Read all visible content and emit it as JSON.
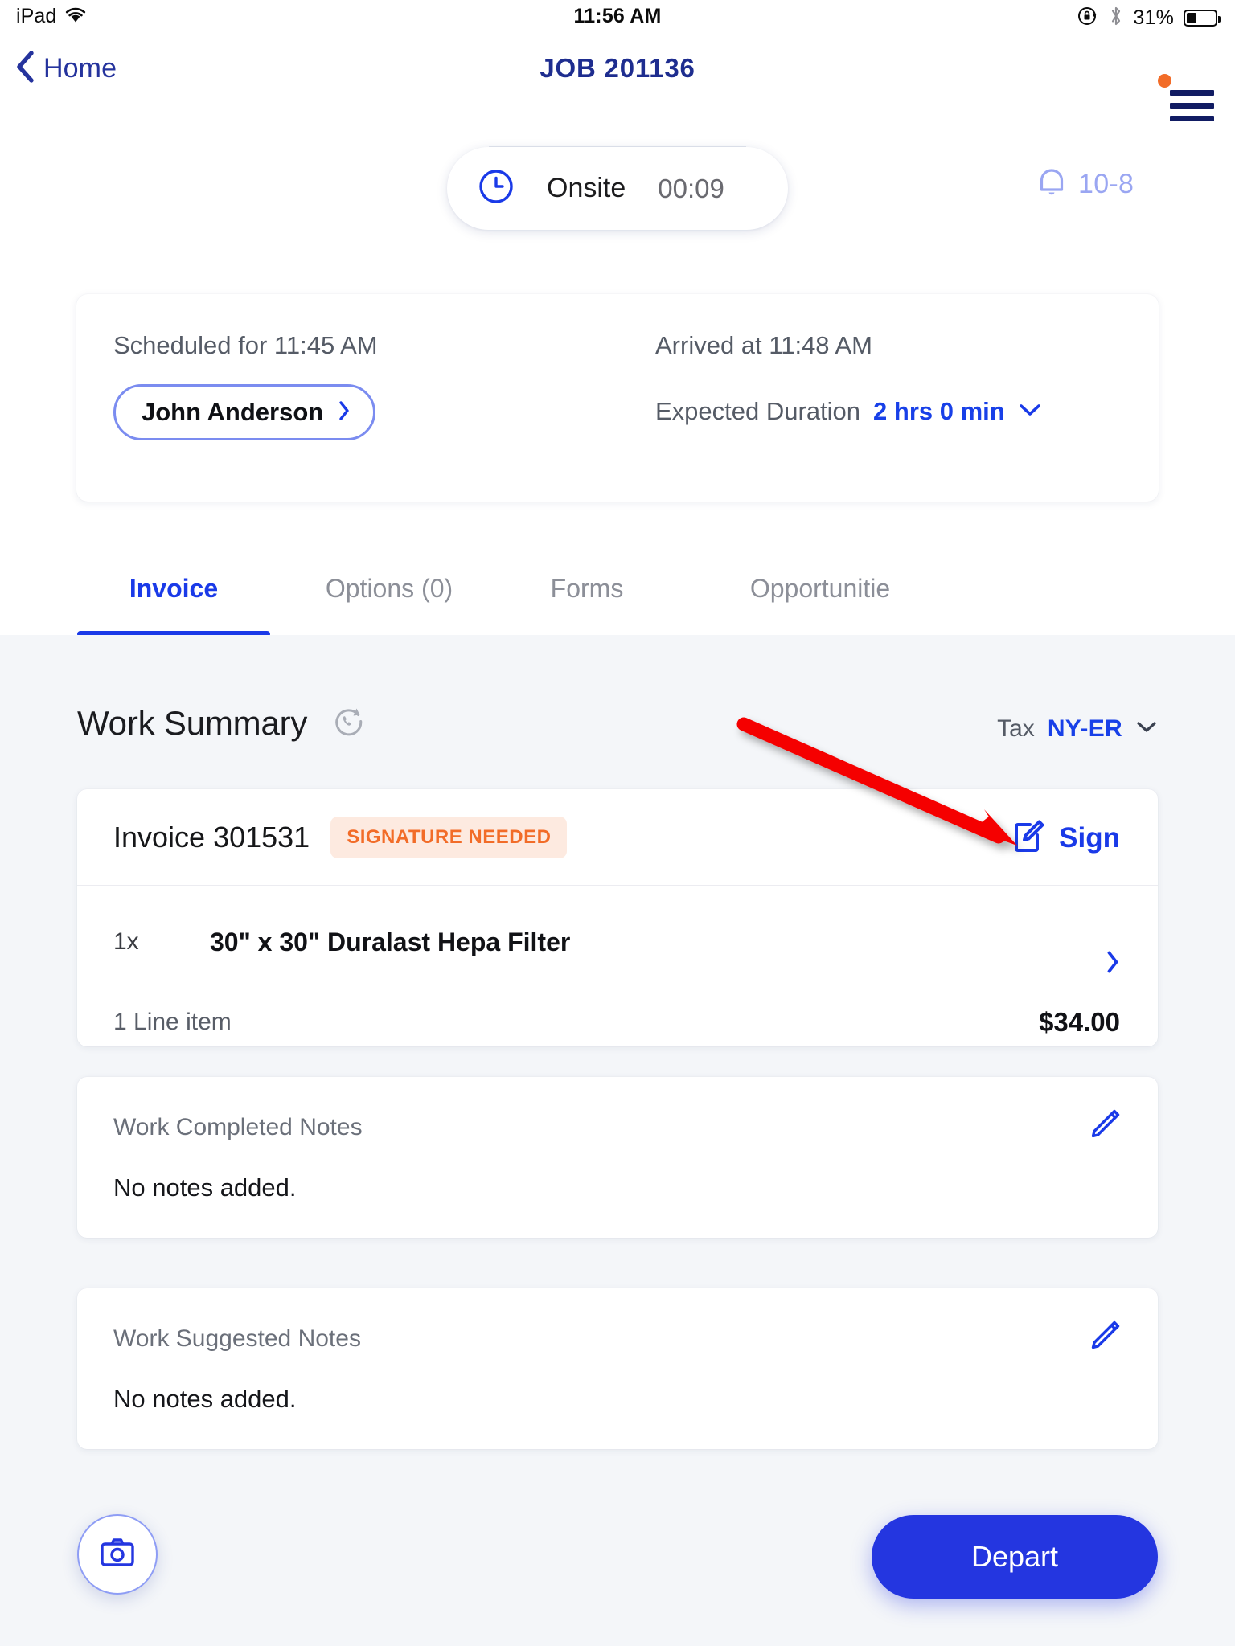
{
  "status_bar": {
    "device": "iPad",
    "wifi_icon": "wifi-icon",
    "time": "11:56 AM",
    "rotation_lock_icon": "rotation-lock-icon",
    "bluetooth_icon": "bluetooth-icon",
    "battery_percent": "31%",
    "battery_level": 31
  },
  "navbar": {
    "back_label": "Home",
    "back_icon": "chevron-left-icon",
    "title": "JOB 201136",
    "menu_icon": "hamburger-menu-icon",
    "menu_badge_color": "#f26c28"
  },
  "status_pill": {
    "clock_icon": "clock-icon",
    "label": "Onsite",
    "elapsed": "00:09"
  },
  "notifications": {
    "bell_icon": "bell-icon",
    "count_label": "10-8"
  },
  "info_card": {
    "scheduled": "Scheduled for 11:45 AM",
    "technician": "John Anderson",
    "technician_chevron_icon": "chevron-right-icon",
    "arrived": "Arrived at 11:48 AM",
    "duration_label": "Expected Duration",
    "duration_value": "2 hrs 0 min",
    "duration_chevron_icon": "chevron-down-icon"
  },
  "tabs": [
    {
      "label": "Invoice",
      "active": true
    },
    {
      "label": "Options (0)",
      "active": false
    },
    {
      "label": "Forms",
      "active": false
    },
    {
      "label": "Opportunitie",
      "active": false
    }
  ],
  "work_summary": {
    "title": "Work Summary",
    "history_icon": "call-history-icon",
    "tax_label": "Tax",
    "tax_value": "NY-ER",
    "tax_chevron_icon": "chevron-down-icon"
  },
  "invoice": {
    "title": "Invoice 301531",
    "badge": "SIGNATURE NEEDED",
    "badge_text_color": "#f26c28",
    "badge_bg_color": "#fdeae0",
    "sign_label": "Sign",
    "sign_icon": "document-edit-icon",
    "line_items": [
      {
        "qty": "1x",
        "name": "30\" x 30\" Duralast Hepa Filter"
      }
    ],
    "row_chevron_icon": "chevron-right-icon",
    "footer_label": "1 Line item",
    "footer_total": "$34.00"
  },
  "notes": [
    {
      "label": "Work Completed Notes",
      "body": "No notes added.",
      "edit_icon": "pencil-icon"
    },
    {
      "label": "Work Suggested Notes",
      "body": "No notes added.",
      "edit_icon": "pencil-icon"
    }
  ],
  "actions": {
    "camera_icon": "camera-icon",
    "depart_label": "Depart"
  },
  "annotation": {
    "arrow_color": "#f50000",
    "points_to": "sign-button"
  },
  "theme": {
    "accent_blue": "#1a3ae8",
    "nav_blue": "#1e2d8f",
    "page_bg": "#f4f6f9",
    "card_bg": "#ffffff"
  }
}
